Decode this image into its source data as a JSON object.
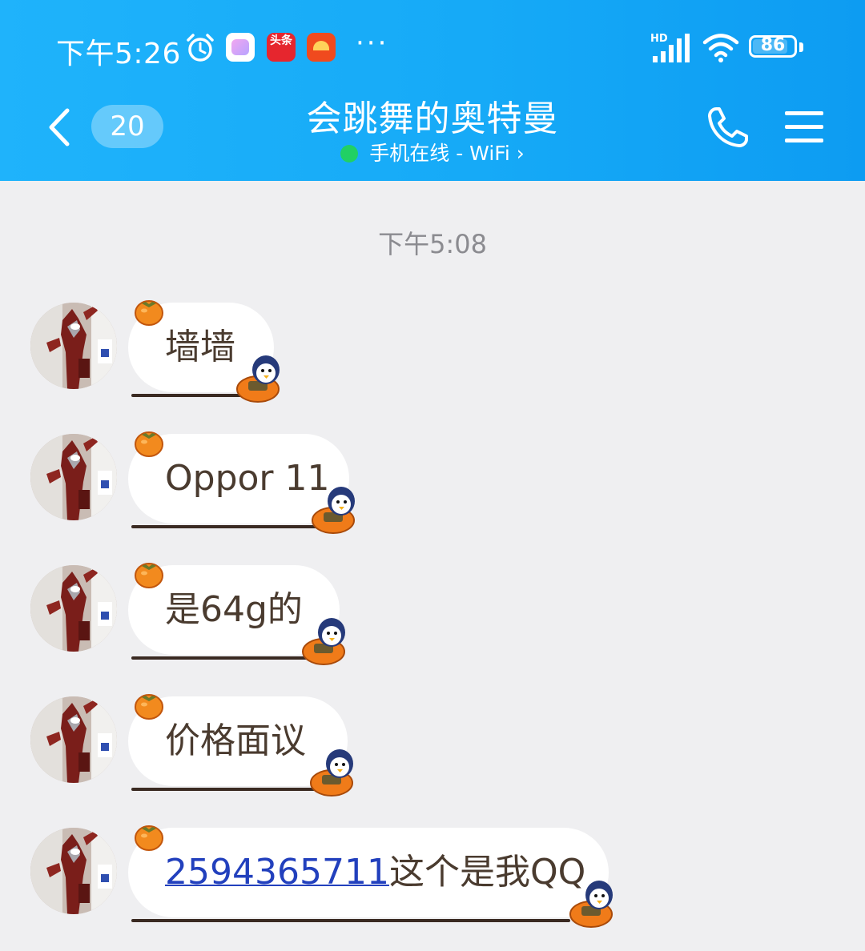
{
  "status_bar": {
    "time": "下午5:26",
    "icons": [
      "alarm-icon",
      "app-icon-photo",
      "app-icon-toutiao",
      "app-icon-red",
      "more-dots-icon",
      "hd-signal-icon",
      "wifi-icon",
      "battery-icon"
    ],
    "app2_label": "头条",
    "more": "···",
    "network": "HD",
    "battery": "86",
    "battery_level": 0.86
  },
  "chat_header": {
    "unread_count": "20",
    "contact_name": "会跳舞的奥特曼",
    "online_status": "手机在线 - WiFi",
    "online_chevron": "›",
    "status_color": "#21d064",
    "header_color": "#16aaf7"
  },
  "timestamp": "下午5:08",
  "messages": [
    {
      "text": "墙墙"
    },
    {
      "text": "Oppor 11"
    },
    {
      "text": "是64g的"
    },
    {
      "text": "价格面议"
    },
    {
      "link": "2594365711",
      "text": "这个是我QQ"
    }
  ]
}
